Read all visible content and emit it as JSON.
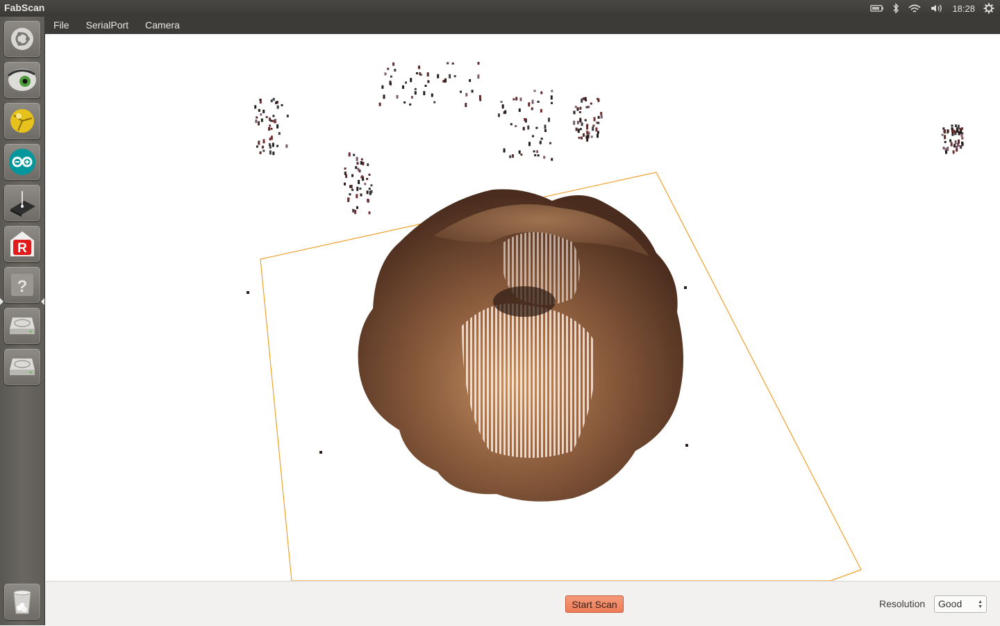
{
  "panel": {
    "app_title": "FabScan",
    "clock": "18:28",
    "tray_icons": [
      "battery-icon",
      "bluetooth-icon",
      "wifi-icon",
      "volume-icon",
      "settings-gear-icon"
    ]
  },
  "launcher": {
    "items": [
      {
        "name": "dash-home",
        "icon": "ubuntu-logo-icon"
      },
      {
        "name": "eye-app",
        "icon": "eye-icon"
      },
      {
        "name": "3d-app",
        "icon": "yellow-sphere-icon"
      },
      {
        "name": "arduino",
        "icon": "arduino-infinity-icon"
      },
      {
        "name": "laser-cutter-app",
        "icon": "laser-icon"
      },
      {
        "name": "r-app",
        "icon": "red-r-icon"
      },
      {
        "name": "fabscan-app",
        "icon": "question-mark-icon"
      },
      {
        "name": "drive-1",
        "icon": "drive-icon"
      },
      {
        "name": "drive-2",
        "icon": "drive-icon"
      },
      {
        "name": "trash",
        "icon": "trash-icon"
      }
    ]
  },
  "menu": {
    "file": "File",
    "serialport": "SerialPort",
    "camera": "Camera"
  },
  "controls": {
    "start_scan": "Start Scan",
    "resolution_label": "Resolution",
    "resolution_value": "Good"
  },
  "colors": {
    "frame_outline": "#f0a028",
    "start_scan_bg": "#ee7c57",
    "panel_bg": "#3c3b37"
  }
}
